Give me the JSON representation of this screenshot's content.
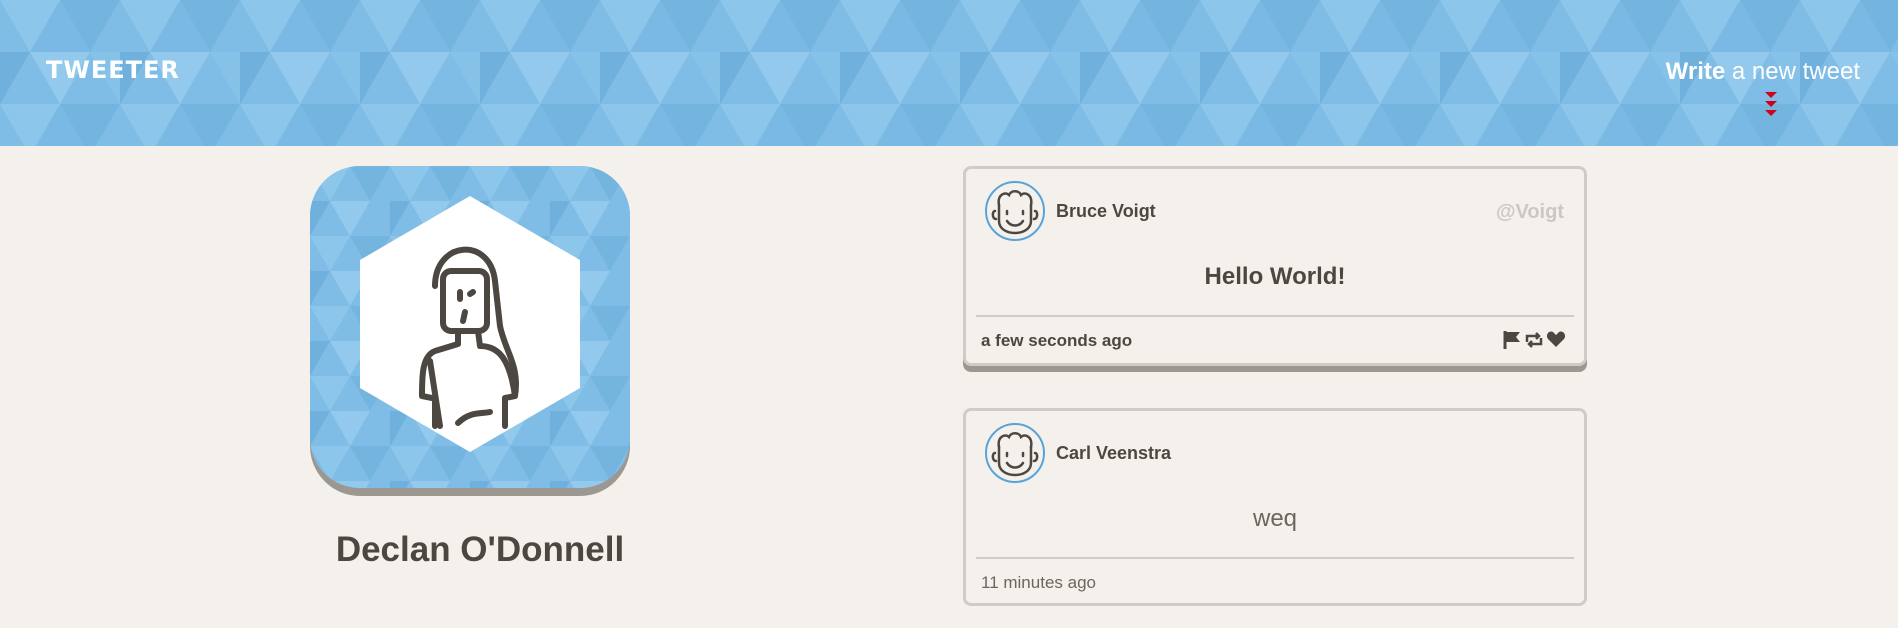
{
  "header": {
    "logo": "TWEETER",
    "write_bold": "Write",
    "write_rest": " a new tweet",
    "accent_color": "#7fbde6",
    "arrow_color": "#d0021b"
  },
  "profile": {
    "name": "Declan O'Donnell",
    "avatar_icon": "woman-avatar-icon"
  },
  "tweets": [
    {
      "author": "Bruce Voigt",
      "handle": "@Voigt",
      "content": "Hello World!",
      "timestamp": "a few seconds ago",
      "actions": [
        "flag-icon",
        "retweet-icon",
        "heart-icon"
      ]
    },
    {
      "author": "Carl Veenstra",
      "handle": "",
      "content": "weq",
      "timestamp": "11 minutes ago"
    }
  ]
}
